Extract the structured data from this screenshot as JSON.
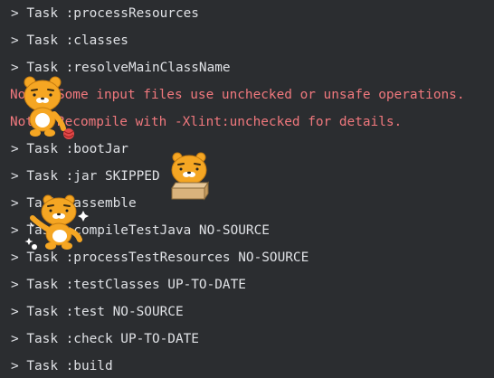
{
  "console": {
    "lines": [
      {
        "text": "> Task :processResources",
        "kind": "normal"
      },
      {
        "text": "> Task :classes",
        "kind": "normal"
      },
      {
        "text": "> Task :resolveMainClassName",
        "kind": "normal"
      },
      {
        "text": "Note: Some input files use unchecked or unsafe operations.",
        "kind": "warning"
      },
      {
        "text": "Note: Recompile with -Xlint:unchecked for details.",
        "kind": "warning"
      },
      {
        "text": "> Task :bootJar",
        "kind": "normal"
      },
      {
        "text": "> Task :jar SKIPPED",
        "kind": "normal"
      },
      {
        "text": "> Task :assemble",
        "kind": "normal"
      },
      {
        "text": "> Task :compileTestJava NO-SOURCE",
        "kind": "normal"
      },
      {
        "text": "> Task :processTestResources NO-SOURCE",
        "kind": "normal"
      },
      {
        "text": "> Task :testClasses UP-TO-DATE",
        "kind": "normal"
      },
      {
        "text": "> Task :test NO-SOURCE",
        "kind": "normal"
      },
      {
        "text": "> Task :check UP-TO-DATE",
        "kind": "normal"
      },
      {
        "text": "> Task :build",
        "kind": "normal"
      }
    ]
  },
  "colors": {
    "background": "#2b2d30",
    "text": "#dfe1e5",
    "warning": "#f0787d",
    "sticker_fur": "#f5a623"
  },
  "stickers": [
    {
      "name": "ryan-sticker-icon"
    },
    {
      "name": "ryan-box-sticker-icon"
    },
    {
      "name": "ryan-dance-sticker-icon"
    }
  ]
}
